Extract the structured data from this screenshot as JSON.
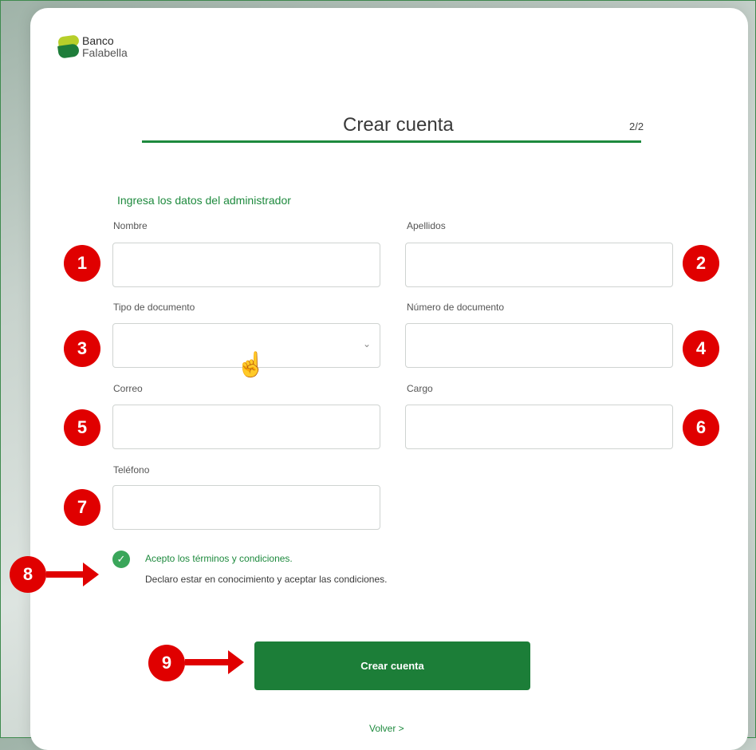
{
  "brand": {
    "line1": "Banco",
    "line2": "Falabella"
  },
  "header": {
    "title": "Crear cuenta",
    "step": "2/2"
  },
  "form": {
    "section_title": "Ingresa los datos del administrador",
    "nombre_label": "Nombre",
    "nombre_value": "",
    "apellidos_label": "Apellidos",
    "apellidos_value": "",
    "tipo_doc_label": "Tipo de documento",
    "tipo_doc_value": "",
    "numero_doc_label": "Número de documento",
    "numero_doc_value": "",
    "correo_label": "Correo",
    "correo_value": "",
    "cargo_label": "Cargo",
    "cargo_value": "",
    "telefono_label": "Teléfono",
    "telefono_value": ""
  },
  "terms": {
    "checked": true,
    "line1": "Acepto los términos y condiciones.",
    "line2": "Declaro estar en conocimiento y aceptar las condiciones."
  },
  "actions": {
    "submit_label": "Crear cuenta",
    "back_label": "Volver >"
  },
  "annotations": [
    "1",
    "2",
    "3",
    "4",
    "5",
    "6",
    "7",
    "8",
    "9"
  ],
  "colors": {
    "brand_green": "#1c7e38",
    "annotation_red": "#e00000"
  },
  "icons": {
    "select": "chevron-down-icon",
    "check": "checkmark-icon",
    "cursor": "hand-pointer-icon"
  }
}
